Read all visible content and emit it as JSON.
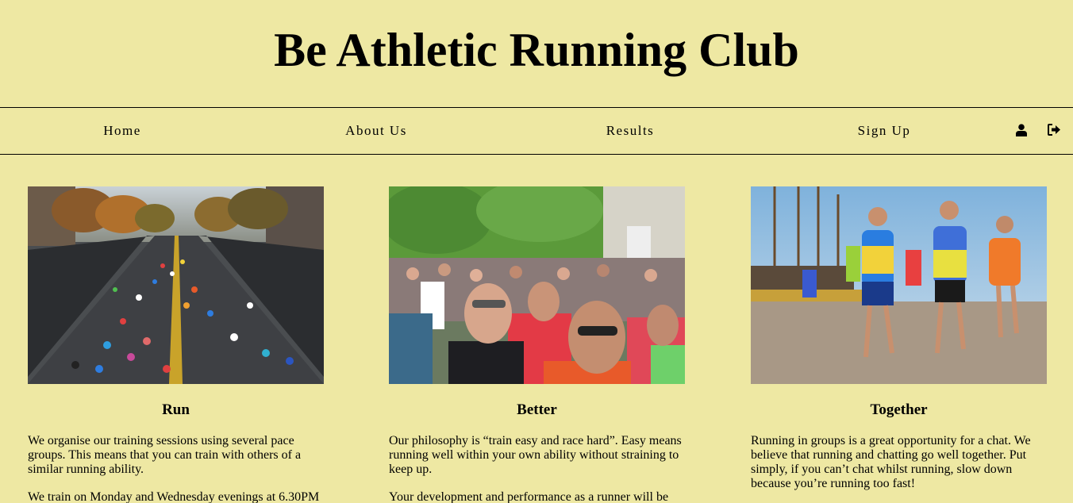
{
  "site": {
    "title": "Be Athletic Running Club"
  },
  "nav": {
    "items": [
      {
        "label": "Home"
      },
      {
        "label": "About Us"
      },
      {
        "label": "Results"
      },
      {
        "label": "Sign Up"
      }
    ],
    "icons": [
      "user-icon",
      "sign-out-icon"
    ]
  },
  "columns": [
    {
      "heading": "Run",
      "image": "runners-city-tunnel-image",
      "paragraphs": [
        "We organise our training sessions using several pace groups. This means that you can train with others of a similar running ability.",
        "We train on Monday and Wednesday evenings at 6.30PM"
      ]
    },
    {
      "heading": "Better",
      "image": "marathon-crowd-image",
      "paragraphs": [
        "Our philosophy is “train easy and race hard”. Easy means running well within your own ability without straining to keep up.",
        "Your development and performance as a runner will be"
      ]
    },
    {
      "heading": "Together",
      "image": "harbour-runners-image",
      "paragraphs": [
        "Running in groups is a great opportunity for a chat. We believe that running and chatting go well together. Put simply, if you can’t chat whilst running, slow down because you’re running too fast!"
      ]
    }
  ],
  "colors": {
    "background": "#eee8a3",
    "text": "#000000"
  }
}
